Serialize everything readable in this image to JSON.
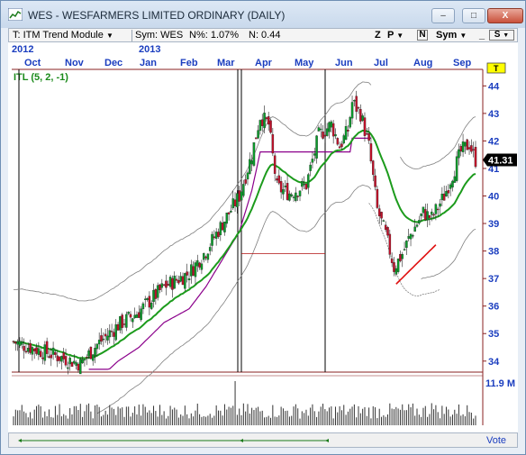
{
  "window": {
    "title": "WES - WESFARMERS LIMITED  ORDINARY (DAILY)",
    "buttons": {
      "minimize": "–",
      "maximize": "□",
      "close": "X"
    }
  },
  "toolbar": {
    "module_label": "T: ITM Trend Module",
    "sym_label": "Sym: WES",
    "n_percent": "N%: 1.07%",
    "n_value": "N: 0.44",
    "buttons": [
      "Z",
      "P",
      "N",
      "Sym",
      "S"
    ]
  },
  "chart": {
    "indicator_label": "ITL (5, 2, -1)",
    "years": [
      "2012",
      "2013"
    ],
    "months": [
      "Oct",
      "Nov",
      "Dec",
      "Jan",
      "Feb",
      "Mar",
      "Apr",
      "May",
      "Jun",
      "Jul",
      "Aug",
      "Sep"
    ],
    "y_ticks": [
      "44",
      "43",
      "42",
      "41",
      "40",
      "39",
      "38",
      "37",
      "36",
      "35",
      "34"
    ],
    "last_price": "41.31",
    "volume_label": "11.9 M",
    "t_marker": "T",
    "colors": {
      "up": "#0a9a2a",
      "down": "#c0102a",
      "trend": "#1c9b1c",
      "stop": "#8b008b",
      "band": "#808080",
      "red_line": "#e01010"
    }
  },
  "chart_data": {
    "type": "candlestick",
    "title": "WES - WESFARMERS LIMITED  ORDINARY (DAILY)",
    "ylim": [
      33.6,
      44.6
    ],
    "x_ticks": [
      "Oct",
      "Nov",
      "Dec",
      "Jan",
      "Feb",
      "Mar",
      "Apr",
      "May",
      "Jun",
      "Jul",
      "Aug",
      "Sep"
    ],
    "y_ticks": [
      34,
      35,
      36,
      37,
      38,
      39,
      40,
      41,
      42,
      43,
      44
    ],
    "closes_by_month_approx": [
      {
        "month": "Oct",
        "close": 34.6
      },
      {
        "month": "Nov",
        "close": 34.0
      },
      {
        "month": "Dec",
        "close": 35.9
      },
      {
        "month": "Jan",
        "close": 37.0
      },
      {
        "month": "Feb",
        "close": 38.8
      },
      {
        "month": "Mar",
        "close": 40.5
      },
      {
        "month": "Apr",
        "close": 42.7
      },
      {
        "month": "May",
        "close": 43.1
      },
      {
        "month": "Jun",
        "close": 37.2
      },
      {
        "month": "Jul",
        "close": 39.2
      },
      {
        "month": "Aug",
        "close": 41.3
      },
      {
        "month": "Sep",
        "close": 41.31
      }
    ],
    "last_price": 41.31,
    "volume_max": "11.9 M"
  }
}
